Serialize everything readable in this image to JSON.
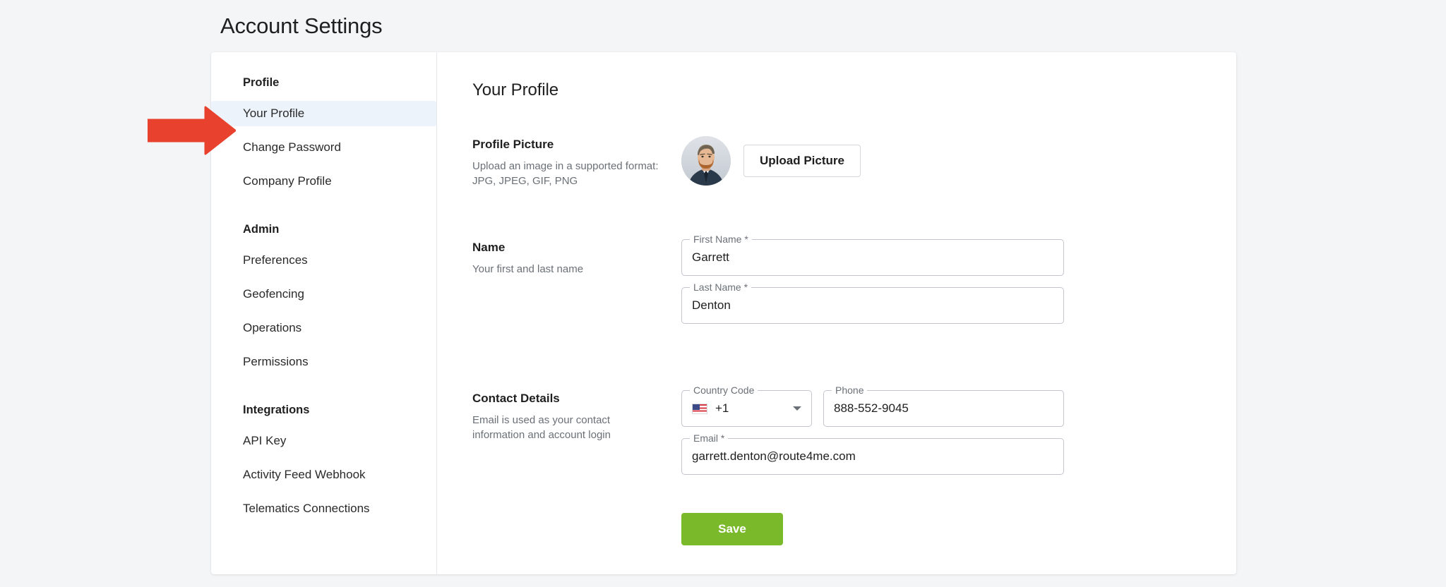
{
  "page": {
    "title": "Account Settings",
    "background_color": "#f4f5f7",
    "card_background": "#ffffff"
  },
  "sidebar": {
    "groups": [
      {
        "title": "Profile",
        "items": [
          {
            "label": "Your Profile",
            "active": true
          },
          {
            "label": "Change Password",
            "active": false
          },
          {
            "label": "Company Profile",
            "active": false
          }
        ]
      },
      {
        "title": "Admin",
        "items": [
          {
            "label": "Preferences",
            "active": false
          },
          {
            "label": "Geofencing",
            "active": false
          },
          {
            "label": "Operations",
            "active": false
          },
          {
            "label": "Permissions",
            "active": false
          }
        ]
      },
      {
        "title": "Integrations",
        "items": [
          {
            "label": "API Key",
            "active": false
          },
          {
            "label": "Activity Feed Webhook",
            "active": false
          },
          {
            "label": "Telematics Connections",
            "active": false
          }
        ]
      }
    ],
    "active_highlight_color": "#ecf3fb"
  },
  "main": {
    "heading": "Your Profile",
    "profile_picture": {
      "title": "Profile Picture",
      "description": "Upload an image in a supported format: JPG, JPEG, GIF, PNG",
      "avatar_alt": "user-avatar-photo",
      "upload_button": "Upload Picture"
    },
    "name": {
      "title": "Name",
      "description": "Your first and last name",
      "first_name_label": "First Name *",
      "first_name_value": "Garrett",
      "last_name_label": "Last Name *",
      "last_name_value": "Denton"
    },
    "contact": {
      "title": "Contact Details",
      "description": "Email is used as your contact information and account login",
      "country_code_label": "Country Code",
      "country_code_value": "+1",
      "country_flag": "us-flag-icon",
      "phone_label": "Phone",
      "phone_value": "888-552-9045",
      "email_label": "Email *",
      "email_value": "garrett.denton@route4me.com"
    },
    "save_label": "Save",
    "save_color": "#7ab929"
  },
  "annotation": {
    "arrow_name": "red-arrow-pointing-to-your-profile",
    "arrow_color": "#e8412d"
  }
}
